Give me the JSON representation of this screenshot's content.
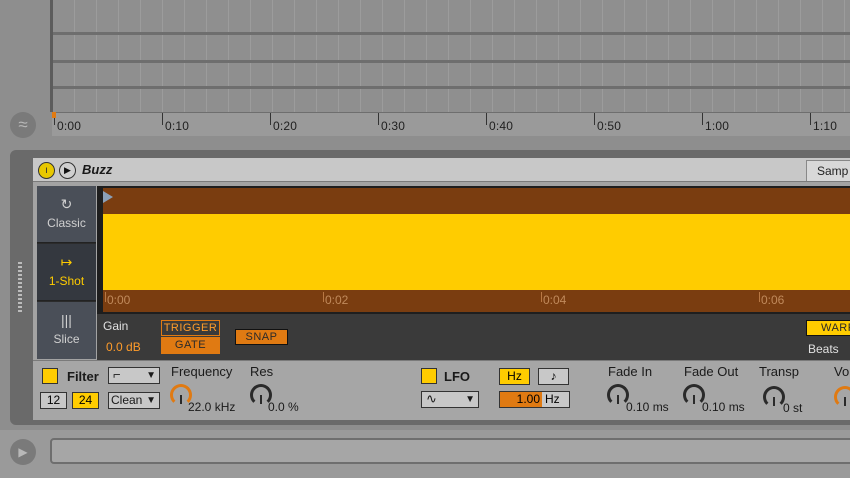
{
  "arrangement": {
    "ruler_labels": [
      "0:00",
      "0:10",
      "0:20",
      "0:30",
      "0:40",
      "0:50",
      "1:00",
      "1:10"
    ],
    "follow_icon": "wave-follow-icon"
  },
  "device": {
    "name": "Buzz",
    "tab": "Samp",
    "modes": [
      {
        "label": "Classic",
        "icon": "loop-icon"
      },
      {
        "label": "1-Shot",
        "icon": "one-shot-icon"
      },
      {
        "label": "Slice",
        "icon": "slice-icon"
      }
    ],
    "active_mode": "1-Shot",
    "waveform": {
      "time_labels": [
        "0:00",
        "0:02",
        "0:04",
        "0:06"
      ]
    },
    "gain_label": "Gain",
    "gain_value": "0.0 dB",
    "trigger_label": "TRIGGER",
    "gate_label": "GATE",
    "snap_label": "SNAP",
    "warp_label": "WARP",
    "beats_label": "Beats"
  },
  "controls": {
    "filter_label": "Filter",
    "filter_type_arrow": "▼",
    "slope_12": "12",
    "slope_24": "24",
    "circuit": "Clean",
    "circuit_arrow": "▼",
    "frequency_label": "Frequency",
    "frequency_value": "22.0 kHz",
    "res_label": "Res",
    "res_value": "0.0 %",
    "lfo_label": "LFO",
    "lfo_wave_arrow": "▼",
    "hz_label": "Hz",
    "note_label": "♪",
    "rate_value": "1.00",
    "rate_unit": "Hz",
    "fade_in_label": "Fade In",
    "fade_in_value": "0.10 ms",
    "fade_out_label": "Fade Out",
    "fade_out_value": "0.10 ms",
    "transp_label": "Transp",
    "transp_value": "0 st",
    "vol_label": "Vo"
  },
  "colors": {
    "accent_yellow": "#ffcc00",
    "accent_orange": "#e07a12",
    "waveform_bg": "#7a3d10"
  }
}
